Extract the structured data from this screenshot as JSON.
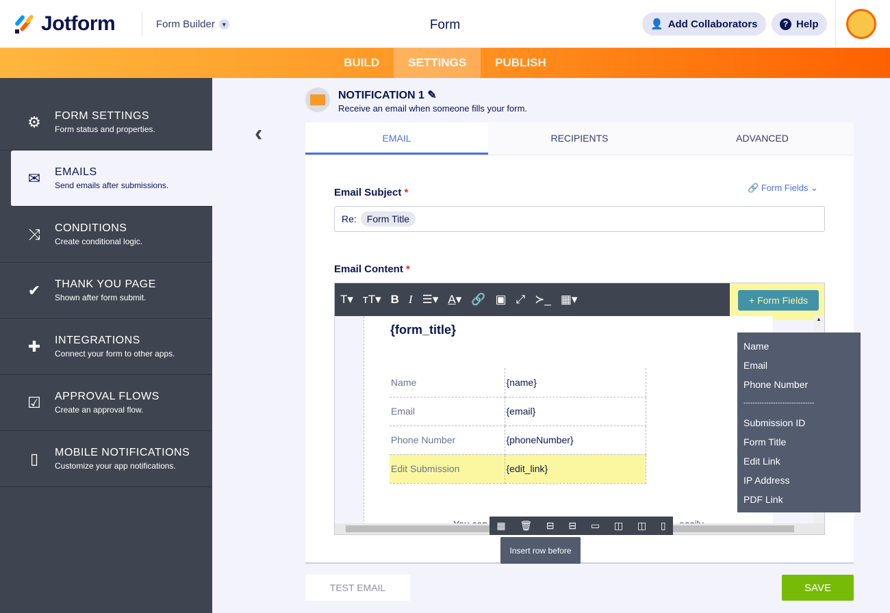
{
  "header": {
    "brand": "Jotform",
    "form_builder": "Form Builder",
    "title": "Form",
    "add_collaborators": "Add Collaborators",
    "help": "Help"
  },
  "nav": {
    "tabs": [
      "BUILD",
      "SETTINGS",
      "PUBLISH"
    ],
    "active": "SETTINGS"
  },
  "sidebar": {
    "items": [
      {
        "title": "FORM SETTINGS",
        "desc": "Form status and properties."
      },
      {
        "title": "EMAILS",
        "desc": "Send emails after submissions."
      },
      {
        "title": "CONDITIONS",
        "desc": "Create conditional logic."
      },
      {
        "title": "THANK YOU PAGE",
        "desc": "Shown after form submit."
      },
      {
        "title": "INTEGRATIONS",
        "desc": "Connect your form to other apps."
      },
      {
        "title": "APPROVAL FLOWS",
        "desc": "Create an approval flow."
      },
      {
        "title": "MOBILE NOTIFICATIONS",
        "desc": "Customize your app notifications."
      }
    ]
  },
  "notification": {
    "title": "NOTIFICATION 1",
    "subtitle": "Receive an email when someone fills your form."
  },
  "tabs": [
    "EMAIL",
    "RECIPIENTS",
    "ADVANCED"
  ],
  "subject": {
    "label": "Email Subject",
    "required": "*",
    "form_fields": "Form Fields",
    "prefix": "Re:",
    "tag": "Form Title"
  },
  "content": {
    "label": "Email Content",
    "required": "*",
    "form_fields_button": "+ Form Fields",
    "form_title": "{form_title}",
    "rows": [
      {
        "label": "Name",
        "value": "{name}"
      },
      {
        "label": "Email",
        "value": "{email}"
      },
      {
        "label": "Phone Number",
        "value": "{phoneNumber}"
      },
      {
        "label": "Edit Submission",
        "value": "{edit_link}"
      }
    ],
    "footer_partial_left": "You can",
    "footer_partial_right": "easily"
  },
  "fields_menu": [
    "Name",
    "Email",
    "Phone Number",
    "-------------------------------",
    "Submission ID",
    "Form Title",
    "Edit Link",
    "IP Address",
    "PDF Link"
  ],
  "tooltip": "Insert row before",
  "buttons": {
    "test_email": "TEST EMAIL",
    "save": "SAVE"
  }
}
